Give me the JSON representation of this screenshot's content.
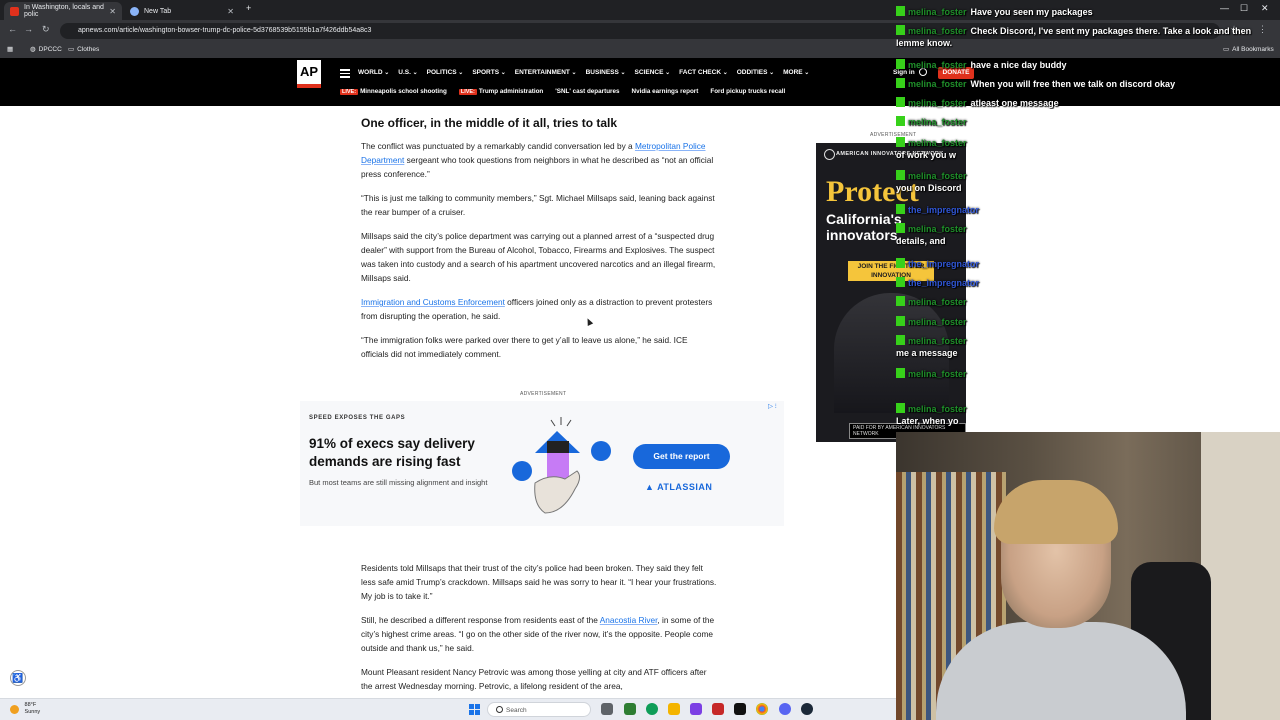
{
  "browser": {
    "tabs": [
      {
        "label": "In Washington, locals and polic",
        "active": true
      },
      {
        "label": "New Tab",
        "active": false
      }
    ],
    "new_tab": "+",
    "address": "apnews.com/article/washington-bowser-trump-dc-police-5d3768539b5155b1a7f426ddb54a8c3",
    "bookmarks": [
      "DPCCC",
      "Clothes"
    ],
    "all_bookmarks": "All Bookmarks"
  },
  "ap": {
    "logo": "AP",
    "nav": [
      "WORLD",
      "U.S.",
      "POLITICS",
      "SPORTS",
      "ENTERTAINMENT",
      "BUSINESS",
      "SCIENCE",
      "FACT CHECK",
      "ODDITIES",
      "MORE"
    ],
    "signin": "Sign in",
    "donate": "DONATE",
    "live_tag": "LIVE:",
    "subnav": [
      {
        "label": "Minneapolis school shooting",
        "live": true
      },
      {
        "label": "Trump administration",
        "live": true
      },
      {
        "label": "'SNL' cast departures",
        "live": false
      },
      {
        "label": "Nvidia earnings report",
        "live": false
      },
      {
        "label": "Ford pickup trucks recall",
        "live": false
      }
    ]
  },
  "article": {
    "heading": "One officer, in the middle of it all, tries to talk",
    "p1_a": "The conflict was punctuated by a remarkably candid conversation led by a ",
    "p1_link": "Metropolitan Police Department",
    "p1_b": " sergeant who took questions from neighbors in what he described as “not an official press conference.”",
    "p2": "“This is just me talking to community members,” Sgt. Michael Millsaps said, leaning back against the rear bumper of a cruiser.",
    "p3": "Millsaps said the city’s police department was carrying out a planned arrest of a “suspected drug dealer” with support from the Bureau of Alcohol, Tobacco, Firearms and Explosives. The suspect was taken into custody and a search of his apartment uncovered narcotics and an illegal firearm, Millsaps said.",
    "p4_link": "Immigration and Customs Enforcement",
    "p4_b": " officers joined only as a distraction to prevent protesters from disrupting the operation, he said.",
    "p5": "“The immigration folks were parked over there to get y’all to leave us alone,” he said. ICE officials did not immediately comment.",
    "p6": "Residents told Millsaps that their trust of the city’s police had been broken. They said they felt less safe amid Trump’s crackdown. Millsaps said he was sorry to hear it. “I hear your frustrations. My job is to take it.”",
    "p7_a": "Still, he described a different response from residents east of the ",
    "p7_link": "Anacostia River",
    "p7_b": ", in some of the city’s highest crime areas. “I go on the other side of the river now, it’s the opposite. People come outside and thank us,” he said.",
    "p8": "Mount Pleasant resident Nancy Petrovic was among those yelling at city and ATF officers after the arrest Wednesday morning. Petrovic, a lifelong resident of the area,"
  },
  "ads": {
    "label": "ADVERTISEMENT",
    "mid": {
      "kicker": "SPEED EXPOSES THE GAPS",
      "headline": "91% of execs say delivery demands are rising fast",
      "sub": "But most teams are still missing alignment and insight",
      "cta": "Get the report",
      "brand": "▲ ATLASSIAN",
      "adchoices": "▷ ⁝"
    },
    "side": {
      "org": "AMERICAN INNOVATORS NETWORK",
      "headline": "Protect",
      "sub": "California's innovators.",
      "cta": "JOIN THE FIGHT FOR INNOVATION",
      "paid": "PAID FOR BY AMERICAN INNOVATORS NETWORK"
    }
  },
  "chat": [
    {
      "user": "melina_foster",
      "msg": "Have you seen my packages",
      "color": "green"
    },
    {
      "user": "melina_foster",
      "msg": "Check Discord, I've sent my packages there. Take a look and",
      "cont": "then lemme know.",
      "color": "green"
    },
    {
      "user": "melina_foster",
      "msg": "have a nice day buddy",
      "color": "green"
    },
    {
      "user": "melina_foster",
      "msg": "When you will free then we talk on discord okay",
      "color": "green"
    },
    {
      "user": "melina_foster",
      "msg": "atleast one message",
      "color": "green"
    },
    {
      "user": "melina_foster",
      "msg": "",
      "color": "green"
    },
    {
      "user": "melina_foster",
      "msg": "",
      "cont": "of work you w",
      "color": "green"
    },
    {
      "user": "melina_foster",
      "msg": "",
      "cont": "you on Discord",
      "color": "green"
    },
    {
      "user": "the_impregnator",
      "msg": "",
      "color": "blue"
    },
    {
      "user": "melina_foster",
      "msg": "",
      "cont": "details, and",
      "color": "green"
    },
    {
      "user": "the_impregnator",
      "msg": "",
      "color": "blue"
    },
    {
      "user": "the_impregnator",
      "msg": "",
      "color": "blue"
    },
    {
      "user": "melina_foster",
      "msg": "",
      "color": "green"
    },
    {
      "user": "melina_foster",
      "msg": "",
      "color": "green"
    },
    {
      "user": "melina_foster",
      "msg": "",
      "cont": "me a message",
      "color": "green"
    },
    {
      "user": "melina_foster",
      "msg": "",
      "color": "green"
    },
    {
      "user": "melina_foster",
      "msg": "",
      "cont": "Later, when yo",
      "color": "green"
    }
  ],
  "taskbar": {
    "temp": "88°F",
    "condition": "Sunny",
    "search": "Search"
  },
  "accessibility": "♿"
}
